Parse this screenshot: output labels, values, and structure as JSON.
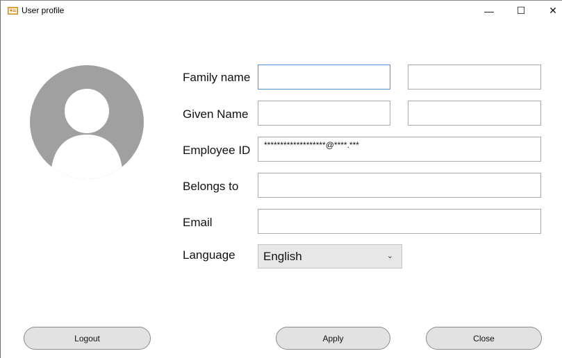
{
  "window": {
    "title": "User profile",
    "icon": "user-profile-app-icon",
    "controls": {
      "minimize": "—",
      "maximize": "☐",
      "close": "✕"
    }
  },
  "avatar": {
    "icon": "default-user-avatar-icon",
    "color": "#a0a0a0"
  },
  "form": {
    "family_name": {
      "label": "Family name",
      "value_primary": "",
      "value_secondary": ""
    },
    "given_name": {
      "label": "Given Name",
      "value_primary": "",
      "value_secondary": ""
    },
    "employee_id": {
      "label": "Employee ID",
      "value": "*******************@****.***"
    },
    "belongs_to": {
      "label": "Belongs to",
      "value": ""
    },
    "email": {
      "label": "Email",
      "value": ""
    },
    "language": {
      "label": "Language",
      "selected": "English",
      "arrow": "⌄"
    }
  },
  "buttons": {
    "logout": "Logout",
    "apply": "Apply",
    "close": "Close"
  },
  "colors": {
    "focus_border": "#4d8fd6",
    "field_border": "#a9a9a9",
    "button_bg": "#e2e2e2"
  }
}
